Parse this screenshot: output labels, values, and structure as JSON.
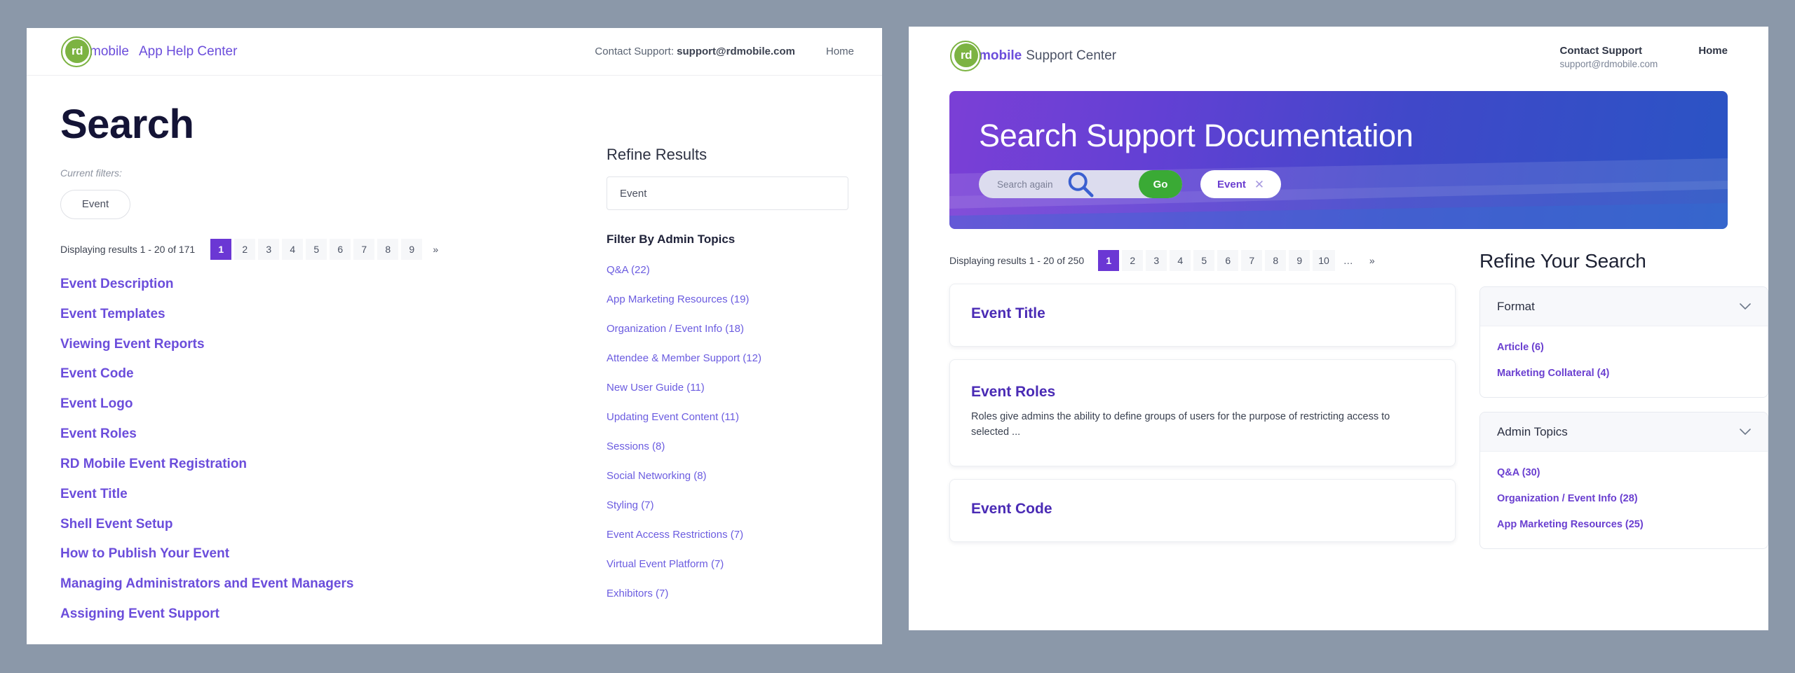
{
  "left_panel": {
    "header": {
      "logo_mark_text": "rd",
      "logo_word": "mobile",
      "site_name": "App Help Center",
      "contact_label": "Contact Support:",
      "contact_email": "support@rdmobile.com",
      "home_label": "Home"
    },
    "page_title": "Search",
    "current_filters_label": "Current filters:",
    "active_filter_chip": "Event",
    "results_count_text": "Displaying results 1 - 20 of 171",
    "pagination": [
      "1",
      "2",
      "3",
      "4",
      "5",
      "6",
      "7",
      "8",
      "9",
      "»"
    ],
    "pagination_active": "1",
    "results": [
      "Event Description",
      "Event Templates",
      "Viewing Event Reports",
      "Event Code",
      "Event Logo",
      "Event Roles",
      "RD Mobile Event Registration",
      "Event Title",
      "Shell Event Setup",
      "How to Publish Your Event",
      "Managing Administrators and Event Managers",
      "Assigning Event Support"
    ],
    "refine": {
      "title": "Refine Results",
      "search_value": "Event",
      "search_placeholder": "Event",
      "filter_heading": "Filter By Admin Topics",
      "filters": [
        "Q&A (22)",
        "App Marketing Resources (19)",
        "Organization / Event Info (18)",
        "Attendee & Member Support (12)",
        "New User Guide (11)",
        "Updating Event Content (11)",
        "Sessions (8)",
        "Social Networking (8)",
        "Styling (7)",
        "Event Access Restrictions (7)",
        "Virtual Event Platform (7)",
        "Exhibitors (7)"
      ]
    }
  },
  "right_panel": {
    "header": {
      "logo_mark_text": "rd",
      "logo_word": "mobile",
      "site_name": "Support Center",
      "contact_label": "Contact Support",
      "contact_email": "support@rdmobile.com",
      "home_label": "Home"
    },
    "hero": {
      "title": "Search Support Documentation",
      "search_placeholder": "Search again",
      "search_value": "",
      "go_label": "Go",
      "chip_label": "Event",
      "chip_remove_icon": "✕",
      "gradient_start": "#7b3fd6",
      "gradient_end": "#2a54c4",
      "go_color": "#3aaa35"
    },
    "results_count_text": "Displaying results 1 - 20 of 250",
    "pagination": [
      "1",
      "2",
      "3",
      "4",
      "5",
      "6",
      "7",
      "8",
      "9",
      "10",
      "…",
      "»"
    ],
    "pagination_active": "1",
    "cards": [
      {
        "title": "Event Title",
        "snippet": ""
      },
      {
        "title": "Event Roles",
        "snippet": "Roles give admins the ability to define groups of users for the purpose of restricting access to selected ..."
      },
      {
        "title": "Event Code",
        "snippet": ""
      }
    ],
    "refine": {
      "title": "Refine Your Search",
      "facets": [
        {
          "heading": "Format",
          "links": [
            "Article (6)",
            "Marketing Collateral (4)"
          ]
        },
        {
          "heading": "Admin Topics",
          "links": [
            "Q&A (30)",
            "Organization / Event Info (28)",
            "App Marketing Resources (25)"
          ]
        }
      ]
    }
  }
}
